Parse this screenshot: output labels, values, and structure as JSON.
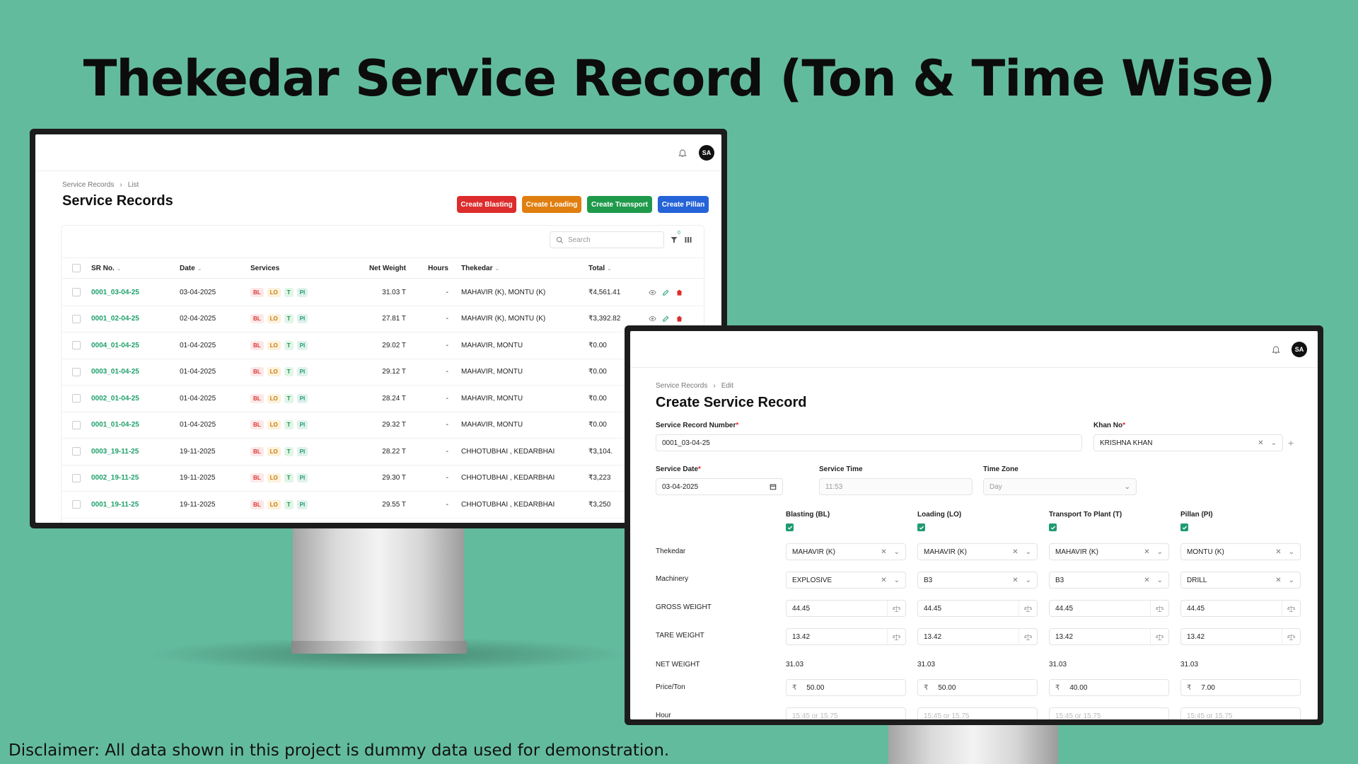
{
  "headline": "Thekedar Service Record (Ton & Time Wise)",
  "disclaimer": "Disclaimer: All data shown in this project is dummy data used for demonstration.",
  "user_initials": "SA",
  "list_screen": {
    "breadcrumb": [
      "Service Records",
      "List"
    ],
    "title": "Service Records",
    "buttons": [
      {
        "label": "Create Blasting",
        "color": "#dc2c2c"
      },
      {
        "label": "Create Loading",
        "color": "#e07f10"
      },
      {
        "label": "Create Transport",
        "color": "#1f9a4a"
      },
      {
        "label": "Create Pillan",
        "color": "#2563d8"
      }
    ],
    "search_placeholder": "Search",
    "filter_count": "0",
    "columns": [
      "SR No.",
      "Date",
      "Services",
      "Net Weight",
      "Hours",
      "Thekedar",
      "Total"
    ],
    "service_codes": [
      "BL",
      "LO",
      "T",
      "PI"
    ],
    "rows": [
      {
        "sr": "0001_03-04-25",
        "date": "03-04-2025",
        "net": "31.03 T",
        "hours": "-",
        "thekedar": "MAHAVIR (K), MONTU (K)",
        "total": "₹4,561.41"
      },
      {
        "sr": "0001_02-04-25",
        "date": "02-04-2025",
        "net": "27.81 T",
        "hours": "-",
        "thekedar": "MAHAVIR (K), MONTU (K)",
        "total": "₹3,392.82"
      },
      {
        "sr": "0004_01-04-25",
        "date": "01-04-2025",
        "net": "29.02 T",
        "hours": "-",
        "thekedar": "MAHAVIR, MONTU",
        "total": "₹0.00"
      },
      {
        "sr": "0003_01-04-25",
        "date": "01-04-2025",
        "net": "29.12 T",
        "hours": "-",
        "thekedar": "MAHAVIR, MONTU",
        "total": "₹0.00"
      },
      {
        "sr": "0002_01-04-25",
        "date": "01-04-2025",
        "net": "28.24 T",
        "hours": "-",
        "thekedar": "MAHAVIR, MONTU",
        "total": "₹0.00"
      },
      {
        "sr": "0001_01-04-25",
        "date": "01-04-2025",
        "net": "29.32 T",
        "hours": "-",
        "thekedar": "MAHAVIR, MONTU",
        "total": "₹0.00"
      },
      {
        "sr": "0003_19-11-25",
        "date": "19-11-2025",
        "net": "28.22 T",
        "hours": "-",
        "thekedar": "CHHOTUBHAI , KEDARBHAI",
        "total": "₹3,104."
      },
      {
        "sr": "0002_19-11-25",
        "date": "19-11-2025",
        "net": "29.30 T",
        "hours": "-",
        "thekedar": "CHHOTUBHAI , KEDARBHAI",
        "total": "₹3,223"
      },
      {
        "sr": "0001_19-11-25",
        "date": "19-11-2025",
        "net": "29.55 T",
        "hours": "-",
        "thekedar": "CHHOTUBHAI , KEDARBHAI",
        "total": "₹3,250"
      }
    ]
  },
  "form_screen": {
    "breadcrumb": [
      "Service Records",
      "Edit"
    ],
    "title": "Create Service Record",
    "service_record_number": {
      "label": "Service Record Number",
      "value": "0001_03-04-25"
    },
    "khan_no": {
      "label": "Khan No",
      "value": "KRISHNA KHAN"
    },
    "service_date": {
      "label": "Service Date",
      "value": "03-04-2025"
    },
    "service_time": {
      "label": "Service Time",
      "value": "11:53"
    },
    "time_zone": {
      "label": "Time Zone",
      "value": "Day"
    },
    "row_labels": {
      "thekedar": "Thekedar",
      "machinery": "Machinery",
      "gross": "GROSS WEIGHT",
      "tare": "TARE WEIGHT",
      "net": "NET WEIGHT",
      "price": "Price/Ton",
      "hour": "Hour"
    },
    "currency": "₹",
    "hour_placeholder": "15:45 or 15.75",
    "services": [
      {
        "name": "Blasting (BL)",
        "thekedar": "MAHAVIR (K)",
        "machinery": "EXPLOSIVE",
        "gross": "44.45",
        "tare": "13.42",
        "net": "31.03",
        "price": "50.00"
      },
      {
        "name": "Loading (LO)",
        "thekedar": "MAHAVIR (K)",
        "machinery": "B3",
        "gross": "44.45",
        "tare": "13.42",
        "net": "31.03",
        "price": "50.00"
      },
      {
        "name": "Transport To Plant (T)",
        "thekedar": "MAHAVIR (K)",
        "machinery": "B3",
        "gross": "44.45",
        "tare": "13.42",
        "net": "31.03",
        "price": "40.00"
      },
      {
        "name": "Pillan (PI)",
        "thekedar": "MONTU (K)",
        "machinery": "DRILL",
        "gross": "44.45",
        "tare": "13.42",
        "net": "31.03",
        "price": "7.00"
      }
    ]
  }
}
